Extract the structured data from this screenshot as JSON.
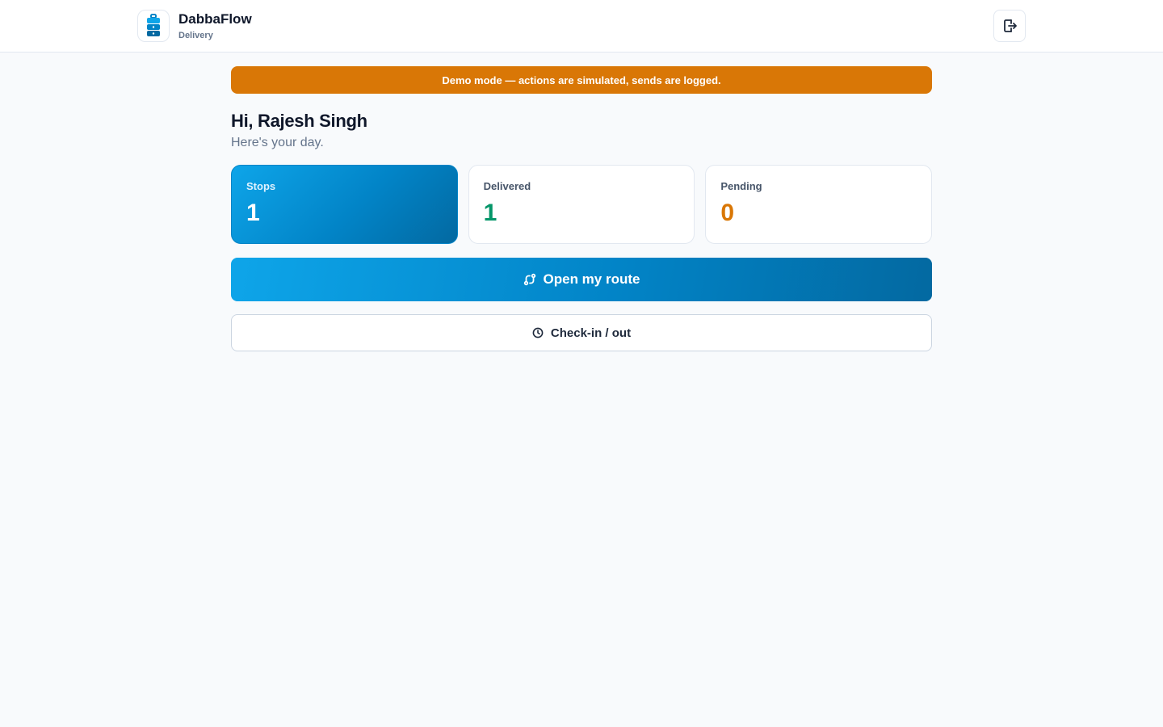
{
  "header": {
    "app_name": "DabbaFlow",
    "app_subtitle": "Delivery",
    "logo_icon": "tiffin-box-icon",
    "logout_icon": "logout-icon"
  },
  "banner": {
    "text": "Demo mode — actions are simulated, sends are logged.",
    "color": "#d97706"
  },
  "greeting": {
    "title": "Hi, Rajesh Singh",
    "subtitle": "Here's your day."
  },
  "stats": {
    "stops": {
      "label": "Stops",
      "value": "1"
    },
    "delivered": {
      "label": "Delivered",
      "value": "1",
      "color": "#059669"
    },
    "pending": {
      "label": "Pending",
      "value": "0",
      "color": "#d97706"
    }
  },
  "actions": {
    "open_route": {
      "label": "Open my route",
      "icon": "route-icon"
    },
    "check_in_out": {
      "label": "Check-in / out",
      "icon": "clock-icon"
    }
  },
  "colors": {
    "accent": "#0284c7",
    "background": "#f8fafc"
  }
}
